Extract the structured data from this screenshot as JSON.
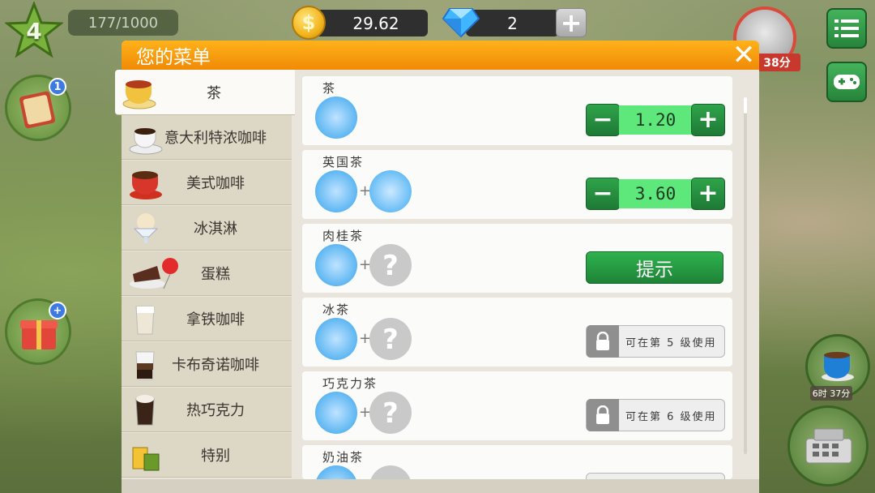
{
  "hud": {
    "level": "4",
    "xp": "177/1000",
    "coins": "29.62",
    "coin_symbol": "$",
    "gems": "2",
    "gem_add": "+",
    "bonus_timer": "38分"
  },
  "left_buttons": [
    {
      "icon": "recipe-book-icon",
      "badge": "1"
    },
    {
      "icon": "gift-box-icon",
      "badge": "+"
    }
  ],
  "right_buttons": [
    {
      "icon": "menu-list-icon"
    },
    {
      "icon": "gamepad-icon"
    }
  ],
  "coffee_machine": {
    "timer": "6时 37分"
  },
  "dialog": {
    "title": "您的菜单",
    "close": "✕",
    "categories": [
      {
        "label": "茶",
        "selected": true,
        "icon": "tea-cup-icon"
      },
      {
        "label": "意大利特浓咖啡",
        "selected": false,
        "icon": "espresso-cup-icon"
      },
      {
        "label": "美式咖啡",
        "selected": false,
        "icon": "americano-cup-icon"
      },
      {
        "label": "冰淇淋",
        "selected": false,
        "icon": "ice-cream-icon"
      },
      {
        "label": "蛋糕",
        "selected": false,
        "icon": "cake-icon"
      },
      {
        "label": "拿铁咖啡",
        "selected": false,
        "icon": "latte-glass-icon"
      },
      {
        "label": "卡布奇诺咖啡",
        "selected": false,
        "icon": "cappuccino-glass-icon"
      },
      {
        "label": "热巧克力",
        "selected": false,
        "icon": "hot-chocolate-icon"
      },
      {
        "label": "特别",
        "selected": false,
        "icon": "special-drink-icon"
      }
    ],
    "recipes": [
      {
        "name": "茶",
        "ingredients": [
          "tea"
        ],
        "action": "stepper",
        "price": "1.20"
      },
      {
        "name": "英国茶",
        "ingredients": [
          "tea",
          "milk"
        ],
        "action": "stepper",
        "price": "3.60"
      },
      {
        "name": "肉桂茶",
        "ingredients": [
          "tea",
          "unknown"
        ],
        "action": "hint",
        "hint_label": "提示"
      },
      {
        "name": "冰茶",
        "ingredients": [
          "tea",
          "unknown"
        ],
        "action": "locked",
        "lock_text": "可在第 5 级使用"
      },
      {
        "name": "巧克力茶",
        "ingredients": [
          "tea",
          "unknown"
        ],
        "action": "locked",
        "lock_text": "可在第 6 级使用"
      },
      {
        "name": "奶油茶",
        "ingredients": [
          "tea",
          "unknown"
        ],
        "action": "locked",
        "lock_text": ""
      }
    ],
    "stepper_minus": "−",
    "stepper_plus": "+",
    "ingredient_plus": "+"
  },
  "colors": {
    "header_orange": "#f59a0b",
    "button_green": "#26913f",
    "price_green": "#5ee87c",
    "panel_bg": "#e9e5dc"
  }
}
